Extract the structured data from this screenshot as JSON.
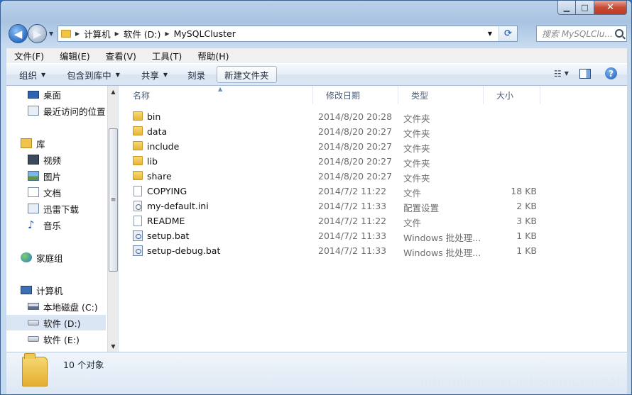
{
  "window": {
    "minimize": "0",
    "maximize": "□",
    "close": "✕"
  },
  "address": {
    "crumbs": [
      "计算机",
      "软件 (D:)",
      "MySQLCluster"
    ],
    "search_placeholder": "搜索 MySQLClu..."
  },
  "menu": [
    "文件(F)",
    "编辑(E)",
    "查看(V)",
    "工具(T)",
    "帮助(H)"
  ],
  "toolbar": {
    "organize": "组织",
    "include_library": "包含到库中",
    "share": "共享",
    "burn": "刻录",
    "new_folder": "新建文件夹"
  },
  "sidebar": {
    "desktop": "桌面",
    "recent": "最近访问的位置",
    "libraries": "库",
    "videos": "视频",
    "pictures": "图片",
    "documents": "文档",
    "xunlei": "迅雷下载",
    "music": "音乐",
    "homegroup": "家庭组",
    "computer": "计算机",
    "drive_c": "本地磁盘 (C:)",
    "drive_d": "软件 (D:)",
    "drive_e": "软件 (E:)"
  },
  "columns": {
    "name": "名称",
    "date": "修改日期",
    "type": "类型",
    "size": "大小"
  },
  "files": [
    {
      "name": "bin",
      "date": "2014/8/20 20:28",
      "type": "文件夹",
      "size": "",
      "icon": "folder-icon"
    },
    {
      "name": "data",
      "date": "2014/8/20 20:27",
      "type": "文件夹",
      "size": "",
      "icon": "folder-icon"
    },
    {
      "name": "include",
      "date": "2014/8/20 20:27",
      "type": "文件夹",
      "size": "",
      "icon": "folder-icon"
    },
    {
      "name": "lib",
      "date": "2014/8/20 20:27",
      "type": "文件夹",
      "size": "",
      "icon": "folder-icon"
    },
    {
      "name": "share",
      "date": "2014/8/20 20:27",
      "type": "文件夹",
      "size": "",
      "icon": "folder-icon"
    },
    {
      "name": "COPYING",
      "date": "2014/7/2 11:22",
      "type": "文件",
      "size": "18 KB",
      "icon": "file-icon"
    },
    {
      "name": "my-default.ini",
      "date": "2014/7/2 11:33",
      "type": "配置设置",
      "size": "2 KB",
      "icon": "config-file-icon"
    },
    {
      "name": "README",
      "date": "2014/7/2 11:22",
      "type": "文件",
      "size": "3 KB",
      "icon": "file-icon"
    },
    {
      "name": "setup.bat",
      "date": "2014/7/2 11:33",
      "type": "Windows 批处理...",
      "size": "1 KB",
      "icon": "batch-file-icon"
    },
    {
      "name": "setup-debug.bat",
      "date": "2014/7/2 11:33",
      "type": "Windows 批处理...",
      "size": "1 KB",
      "icon": "batch-file-icon"
    }
  ],
  "status": {
    "count": "10 个对象"
  },
  "watermark": "http://blog.csdn.net/SmartCodeKM",
  "colors": {
    "accent": "#2b6fc6",
    "selection": "#dbe6f4",
    "close_button": "#c74c36"
  }
}
